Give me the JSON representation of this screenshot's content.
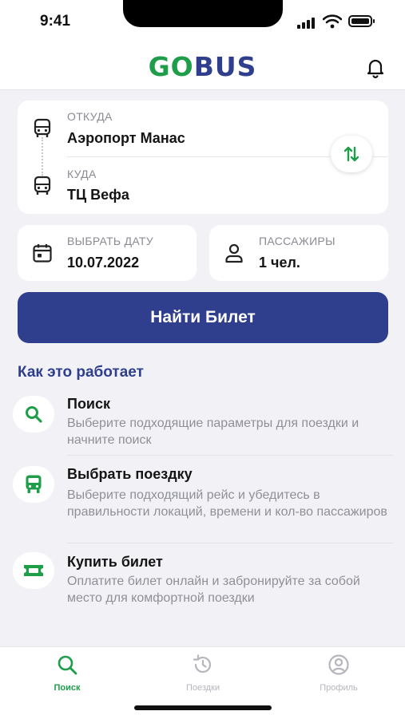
{
  "status_bar": {
    "time": "9:41"
  },
  "header": {
    "logo_go": "GO",
    "logo_bus": "BUS"
  },
  "route": {
    "from_label": "ОТКУДА",
    "from_value": "Аэропорт Манас",
    "to_label": "КУДА",
    "to_value": "ТЦ Вефа"
  },
  "date": {
    "label": "ВЫБРАТЬ ДАТУ",
    "value": "10.07.2022"
  },
  "passengers": {
    "label": "ПАССАЖИРЫ",
    "value": "1 чел."
  },
  "search_button": "Найти Билет",
  "how_it_works": {
    "title": "Как это работает",
    "steps": [
      {
        "icon": "search-icon",
        "title": "Поиск",
        "description": "Выберите подходящие параметры для поездки и начните поиск"
      },
      {
        "icon": "bus-icon",
        "title": "Выбрать поездку",
        "description": "Выберите подходящий рейс и убедитесь в правильности локаций, времени и кол-во пассажиров"
      },
      {
        "icon": "ticket-icon",
        "title": "Купить билет",
        "description": "Оплатите билет онлайн и забронируйте за собой место для комфортной поездки"
      }
    ]
  },
  "tabs": [
    {
      "label": "Поиск",
      "icon": "search-icon",
      "active": true
    },
    {
      "label": "Поездки",
      "icon": "history-icon",
      "active": false
    },
    {
      "label": "Профиль",
      "icon": "profile-icon",
      "active": false
    }
  ],
  "colors": {
    "brand_green": "#1f9e4a",
    "brand_blue": "#2f3e8d",
    "background": "#f2f2f6"
  },
  "battery_level": 1
}
